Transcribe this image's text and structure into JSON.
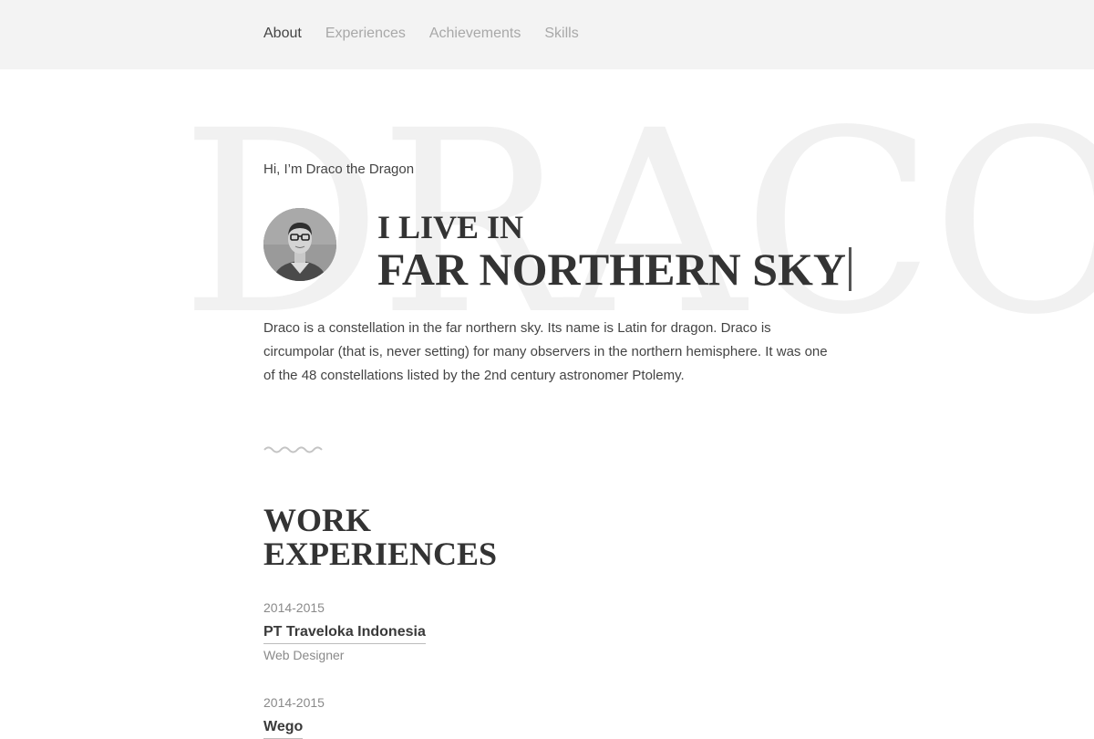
{
  "nav": {
    "items": [
      {
        "label": "About",
        "active": true
      },
      {
        "label": "Experiences",
        "active": false
      },
      {
        "label": "Achievements",
        "active": false
      },
      {
        "label": "Skills",
        "active": false
      }
    ]
  },
  "hero": {
    "background_word": "DRACO",
    "greeting": "Hi, I’m Draco the Dragon",
    "headline_line1": "I LIVE IN",
    "headline_line2": "FAR NORTHERN SKY",
    "intro": "Draco is a constellation in the far northern sky. Its name is Latin for dragon. Draco is circumpolar (that is, never setting) for many observers in the northern hemisphere. It was one of the 48 constellations listed by the 2nd century astronomer Ptolemy."
  },
  "work": {
    "title_line1": "WORK",
    "title_line2": "EXPERIENCES",
    "items": [
      {
        "years": "2014-2015",
        "company": "PT Traveloka Indonesia",
        "role": "Web Designer"
      },
      {
        "years": "2014-2015",
        "company": "Wego",
        "role": ""
      }
    ]
  },
  "colors": {
    "nav_bg": "#f3f3f3",
    "text_dark": "#333333",
    "text_muted": "#a8a8a8",
    "watermark": "#f1f1f1"
  }
}
